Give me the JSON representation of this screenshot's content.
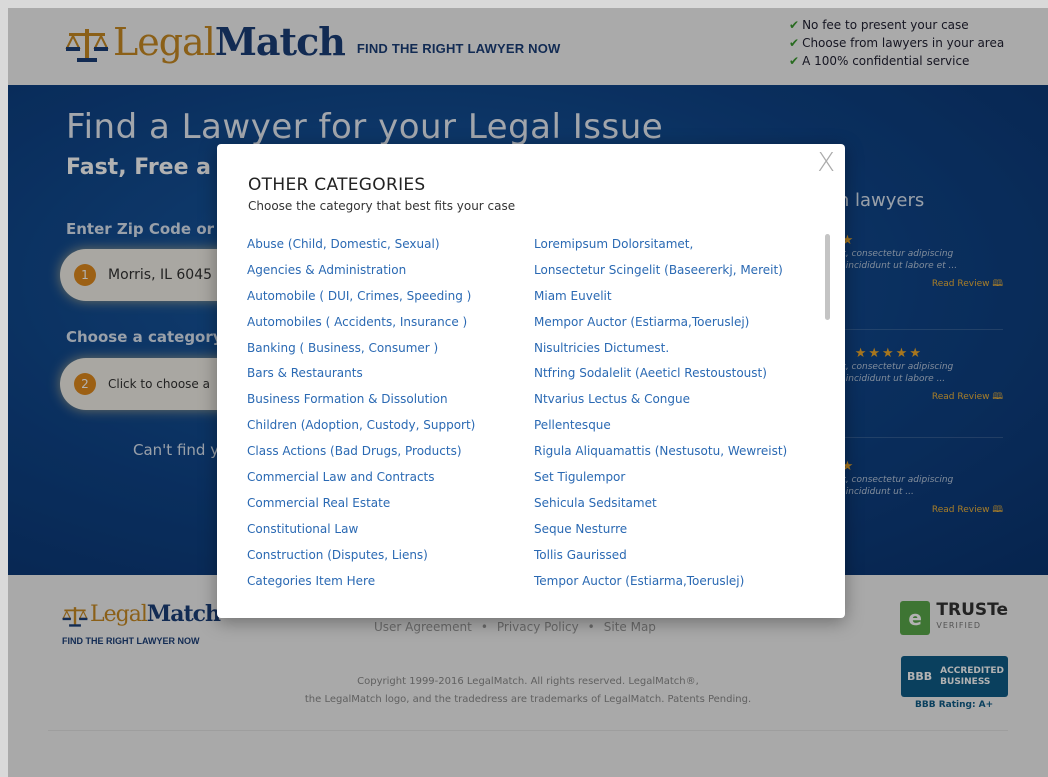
{
  "header": {
    "logo_part1": "Legal",
    "logo_part2": "Match",
    "tagline": "FIND THE RIGHT LAWYER NOW",
    "benefits": [
      "No fee to present your case",
      "Choose from lawyers in your area",
      "A 100% confidential service"
    ]
  },
  "hero": {
    "title": "Find a Lawyer for your Legal Issue",
    "subtitle": "Fast, Free a",
    "zip_label": "Enter Zip Code or C",
    "zip_step": "1",
    "zip_value": "Morris, IL 6045",
    "category_label": "Choose a category:",
    "category_step": "2",
    "category_placeholder": "Click to choose a",
    "cant_find": "Can't find y",
    "reviews_title": "ch lawyers",
    "reviews": [
      {
        "prefix": "",
        "stars": "★★",
        "text1": "met, consectetur adipiscing",
        "text2": "por incididunt ut labore et ...",
        "link": "Read Review"
      },
      {
        "prefix": "w",
        "stars": "★★★★★",
        "text1": "met, consectetur adipiscing",
        "text2": "por incididunt ut labore ...",
        "link": "Read Review"
      },
      {
        "prefix": "",
        "stars": "★★",
        "text1": "met, consectetur adipiscing",
        "text2": "por incididunt ut ...",
        "link": "Read Review"
      }
    ]
  },
  "footer": {
    "logo_part1": "Legal",
    "logo_part2": "Match",
    "tagline": "FIND THE RIGHT LAWYER NOW",
    "links": [
      "User Agreement",
      "Privacy Policy",
      "Site Map"
    ],
    "copyright1": "Copyright 1999-2016 LegalMatch. All rights reserved. LegalMatch®,",
    "copyright2": "the LegalMatch logo, and the tradedress are trademarks of LegalMatch. Patents Pending.",
    "truste_name": "TRUSTe",
    "truste_sub": "VERIFIED",
    "bbb_mark": "BBB",
    "bbb_text1": "ACCREDITED",
    "bbb_text2": "BUSINESS",
    "bbb_rating": "BBB Rating: A+"
  },
  "modal": {
    "close": "X",
    "title": "OTHER CATEGORIES",
    "subtitle": "Choose the category that best fits your case",
    "col1": [
      "Abuse (Child, Domestic, Sexual)",
      "Agencies & Administration",
      "Automobile ( DUI, Crimes, Speeding )",
      "Automobiles ( Accidents, Insurance )",
      "Banking ( Business, Consumer )",
      "Bars & Restaurants",
      "Business Formation & Dissolution",
      "Children (Adoption, Custody, Support)",
      "Class Actions (Bad Drugs, Products)",
      "Commercial Law and Contracts",
      "Commercial Real Estate",
      "Constitutional Law",
      "Construction (Disputes, Liens)",
      "Categories Item Here"
    ],
    "col2": [
      "Loremipsum Dolorsitamet,",
      "Lonsectetur Scingelit  (Baseererkj, Mereit)",
      "Miam Euvelit",
      "Mempor Auctor (Estiarma,Toeruslej)",
      "Nisultricies Dictumest.",
      "Ntfring Sodalelit (Aeeticl Restoustoust)",
      "Ntvarius Lectus & Congue",
      "Pellentesque",
      "Rigula Aliquamattis (Nestusotu, Wewreist)",
      "Set Tigulempor",
      "Sehicula Sedsitamet",
      "Seque Nesturre",
      "Tollis Gaurissed",
      "Tempor Auctor (Estiarma,Toeruslej)"
    ]
  }
}
